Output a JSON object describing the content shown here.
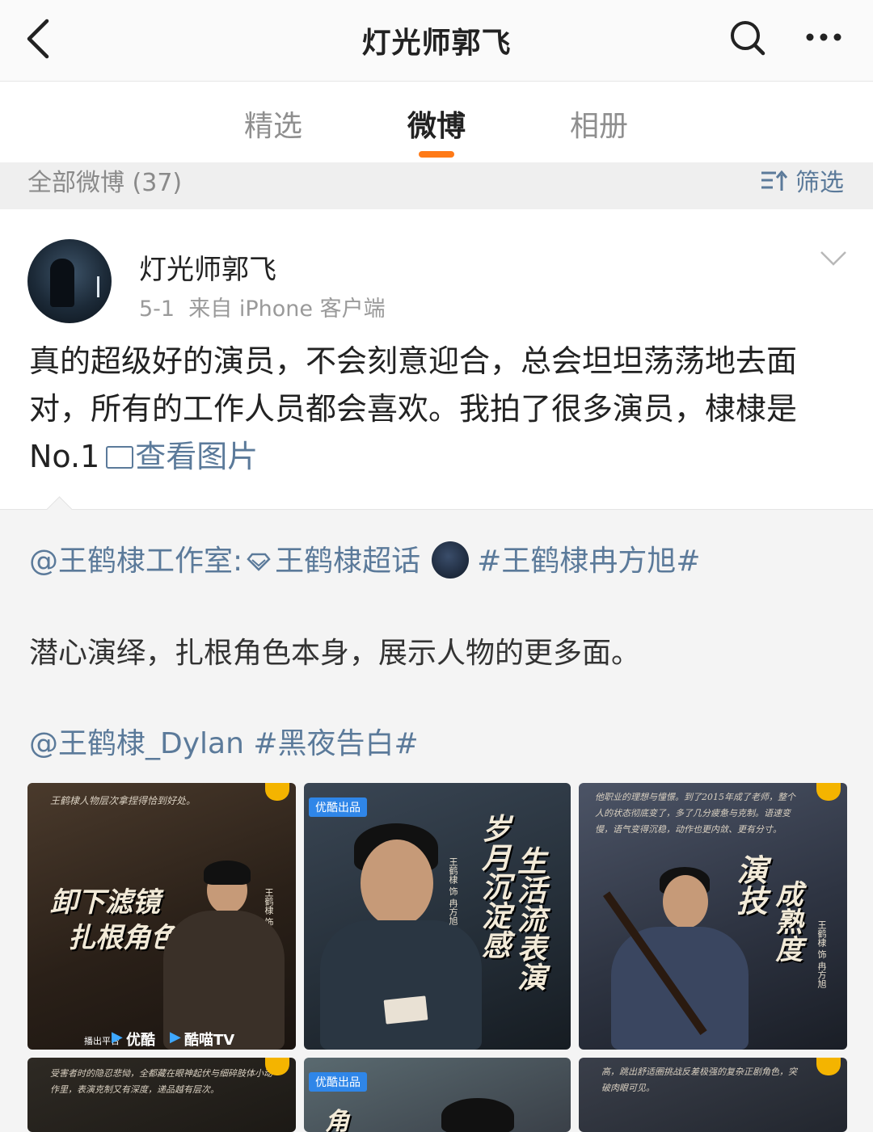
{
  "nav": {
    "title": "灯光师郭飞"
  },
  "tabs": [
    {
      "label": "精选"
    },
    {
      "label": "微博"
    },
    {
      "label": "相册"
    }
  ],
  "active_tab": "微博",
  "filter": {
    "count_label": "全部微博 (37)",
    "filter_label": "筛选"
  },
  "post": {
    "author": "灯光师郭飞",
    "date": "5-1",
    "source": "来自 iPhone 客户端",
    "text": "真的超级好的演员，不会刻意迎合，总会坦坦荡荡地去面对，所有的工作人员都会喜欢。我拍了很多演员，棣棣是 No.1",
    "view_images": "查看图片"
  },
  "repost": {
    "mention1": "@王鹤棣工作室:",
    "supertopic": "王鹤棣超话",
    "hashtag1": "#王鹤棣冉方旭#",
    "body": "潜心演绎，扎根角色本身，展示人物的更多面。",
    "mention2": "@王鹤棣_Dylan",
    "hashtag2": "#黑夜告白#"
  },
  "images": {
    "img1": {
      "caption_top": "王鹤棣人物层次拿捏得恰到好处。",
      "title1": "卸下滤镜",
      "title2": "扎根角色",
      "credit": "王鹤棣 饰 冉方旭",
      "platform_label": "播出平台",
      "logo1": "优酷",
      "logo2": "酷喵TV"
    },
    "img2": {
      "badge": "优酷出品",
      "col1": "岁月沉淀感",
      "col2": "生活流表演",
      "credit": "王鹤棣 饰 冉方旭"
    },
    "img3": {
      "caption": "他职业的理想与憧憬。到了2015年成了老师，整个人的状态彻底变了，多了几分疲惫与克制。语速变慢，语气变得沉稳，动作也更内敛、更有分寸。",
      "col1": "演技",
      "col2": "成熟度",
      "credit": "王鹤棣 饰 冉方旭"
    },
    "img4": {
      "caption": "受害者时的隐忍悲恸，全都藏在眼神起伏与细碎肢体小动作里，表演克制又有深度，递品越有层次。"
    },
    "img5": {
      "badge": "优酷出品",
      "glyph": "角"
    },
    "img6": {
      "caption": "高，跳出舒适圈挑战反差极强的复杂正剧角色，突破肉眼可见。"
    }
  },
  "colors": {
    "accent": "#ff7a17",
    "link": "#5b7a9a"
  }
}
